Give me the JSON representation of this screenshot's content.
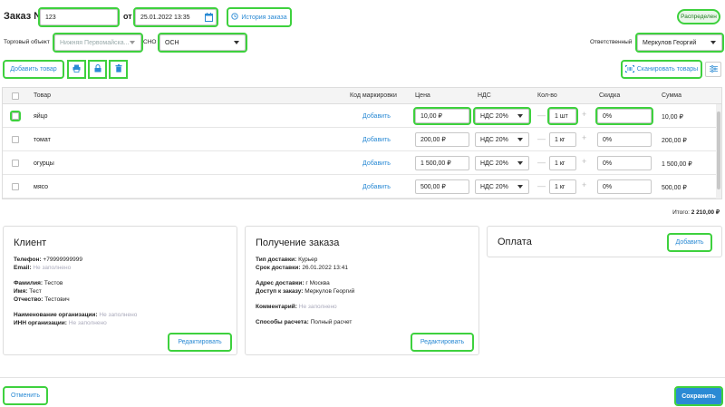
{
  "header": {
    "order_label": "Заказ №",
    "order_number": "123",
    "from_label": "от",
    "date_value": "25.01.2022 13:35",
    "history_label": "История заказа",
    "status_badge": "Распределен"
  },
  "filters": {
    "store_label": "Торговый объект",
    "store_value": "Нижняя Первомайска...",
    "sno_label": "СНО",
    "sno_value": "ОСН",
    "responsible_label": "Ответственный",
    "responsible_value": "Меркулов Георгий"
  },
  "toolbar": {
    "add_product_label": "Добавить товар",
    "scan_label": "Сканировать товары"
  },
  "table": {
    "columns": {
      "product": "Товар",
      "marking": "Код маркировки",
      "price": "Цена",
      "vat": "НДС",
      "qty": "Кол-во",
      "discount": "Скидка",
      "sum": "Сумма"
    },
    "rows": [
      {
        "name": "яйцо",
        "add": "Добавить",
        "price": "10,00 ₽",
        "vat": "НДС 20%",
        "qty": "1 шт",
        "discount": "0%",
        "sum": "10,00 ₽"
      },
      {
        "name": "томат",
        "add": "Добавить",
        "price": "200,00 ₽",
        "vat": "НДС 20%",
        "qty": "1 кг",
        "discount": "0%",
        "sum": "200,00 ₽"
      },
      {
        "name": "огурцы",
        "add": "Добавить",
        "price": "1 500,00 ₽",
        "vat": "НДС 20%",
        "qty": "1 кг",
        "discount": "0%",
        "sum": "1 500,00 ₽"
      },
      {
        "name": "мясо",
        "add": "Добавить",
        "price": "500,00 ₽",
        "vat": "НДС 20%",
        "qty": "1 кг",
        "discount": "0%",
        "sum": "500,00 ₽"
      }
    ],
    "total_label": "Итого:",
    "total_value": "2 210,00 ₽"
  },
  "client": {
    "title": "Клиент",
    "phone_label": "Телефон:",
    "phone_value": "+79999999999",
    "email_label": "Email:",
    "email_value": "Не заполнено",
    "surname_label": "Фамилия:",
    "surname_value": "Тестов",
    "name_label": "Имя:",
    "name_value": "Тест",
    "patronymic_label": "Отчество:",
    "patronymic_value": "Тестович",
    "org_label": "Наименование организации:",
    "org_value": "Не заполнено",
    "inn_label": "ИНН организации:",
    "inn_value": "Не заполнено",
    "edit_label": "Редактировать"
  },
  "delivery": {
    "title": "Получение заказа",
    "type_label": "Тип доставки:",
    "type_value": "Курьер",
    "date_label": "Срок доставки:",
    "date_value": "26.01.2022 13:41",
    "address_label": "Адрес доставки:",
    "address_value": "г Москва",
    "access_label": "Доступ к заказу:",
    "access_value": "Меркулов Георгий",
    "comment_label": "Комментарий:",
    "comment_value": "Не заполнено",
    "pay_methods_label": "Способы расчета:",
    "pay_methods_value": "Полный расчет",
    "edit_label": "Редактировать"
  },
  "payment": {
    "title": "Оплата",
    "add_label": "Добавить"
  },
  "footer": {
    "cancel_label": "Отменить",
    "save_label": "Сохранить"
  },
  "colors": {
    "accent": "#2a8ad4",
    "highlight": "#3ed13e",
    "placeholder": "#aab0bb"
  }
}
